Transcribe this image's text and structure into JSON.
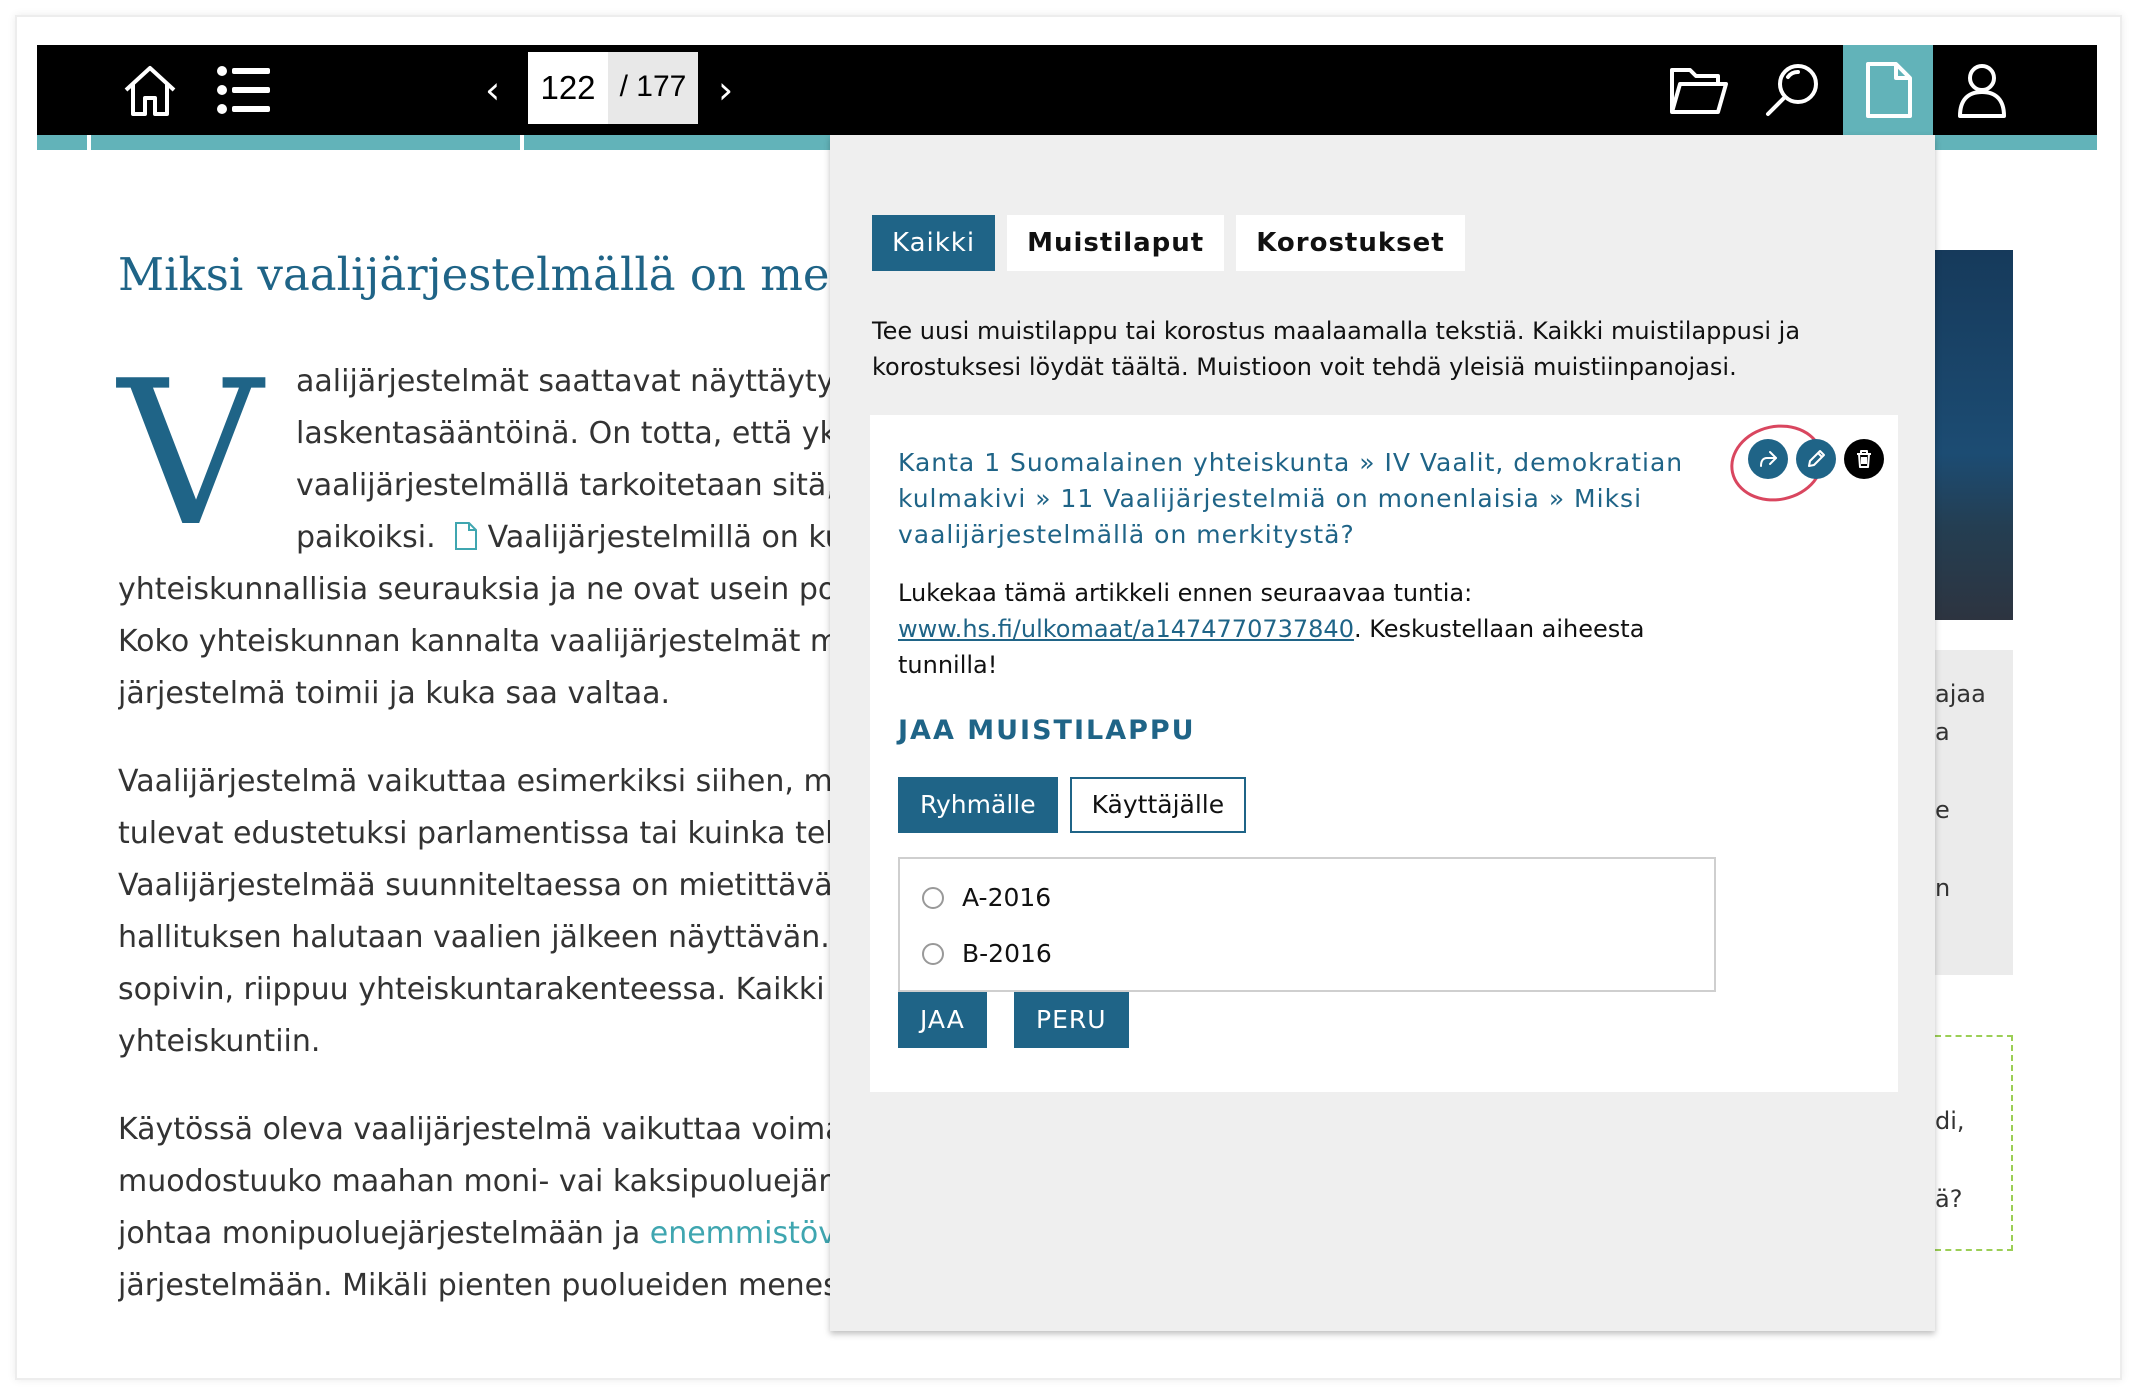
{
  "toolbar": {
    "home_icon": "home-icon",
    "menu_icon": "list-menu-icon",
    "prev_arrow": "‹",
    "next_arrow": "›",
    "current_page": "122",
    "total_pages": "/ 177",
    "folder_icon": "folder-icon",
    "search_icon": "search-icon",
    "notes_icon": "document-icon",
    "user_icon": "user-icon",
    "accent_color": "#62b3b9"
  },
  "article": {
    "title": "Miksi vaalijärjestelmällä on me",
    "dropcap": "V",
    "paragraphs": [
      {
        "lines": [
          "aalijärjestelmät saattavat näyttäytyä v",
          "laskentasääntöinä. On totta, että yksin",
          "vaalijärjestelmällä tarkoitetaan sitä, m",
          "paikoiksi.",
          "yhteiskunnallisia seurauksia ja ne ovat usein poliit",
          "Koko yhteiskunnan kannalta vaalijärjestelmät mää",
          "järjestelmä toimii ja kuka saa valtaa."
        ],
        "inline_link_text": "Vaalijärjestelmillä on ku"
      },
      {
        "lines": [
          "Vaalijärjestelmä vaikuttaa esimerkiksi siihen, miss",
          "tulevat edustetuksi parlamentissa tai kuinka tehok",
          "Vaalijärjestelmää suunniteltaessa on mietittävä ta",
          "hallituksen halutaan vaalien jälkeen näyttävän. Se",
          "sopivin, riippuu yhteiskuntarakenteessa. Kaikki va",
          "yhteiskuntiin."
        ]
      },
      {
        "lines": [
          "Käytössä oleva vaalijärjestelmä vaikuttaa voimakk",
          "muodostuuko maahan moni- vai kaksipuoluejärjes",
          "johtaa monipuoluejärjestelmään ja",
          "järjestelmään. Mikäli pienten puolueiden menesty"
        ],
        "link_text": "enemmistövaa"
      }
    ],
    "heading_color": "#1f6487"
  },
  "side": {
    "box_lines": [
      "ajaa",
      "a",
      "e",
      "n"
    ],
    "dashed_lines": [
      "di,",
      "ä?"
    ]
  },
  "panel": {
    "tabs": [
      "Kaikki",
      "Muistilaput",
      "Korostukset"
    ],
    "intro": "Tee uusi muistilappu tai korostus maalaamalla tekstiä. Kaikki muistilappusi ja korostuksesi löydät täältä. Muistioon voit tehdä yleisiä muistiinpanojasi.",
    "note": {
      "breadcrumb": "Kanta 1 Suomalainen yhteiskunta » IV Vaalit, demokratian kulmakivi » 11 Vaalijärjestelmiä on monenlaisia » Miksi vaalijärjestelmällä on merkitystä?",
      "body_before": "Lukekaa tämä artikkeli ennen seuraavaa tuntia:",
      "link": "www.hs.fi/ulkomaat/a1474770737840",
      "body_after": ". Keskustellaan aiheesta tunnilla!",
      "actions": [
        "share-icon",
        "edit-icon",
        "delete-icon"
      ],
      "share_heading": "JAA MUISTILAPPU",
      "share_tabs": [
        "Ryhmälle",
        "Käyttäjälle"
      ],
      "groups": [
        "A-2016",
        "B-2016"
      ],
      "share_button": "JAA",
      "cancel_button": "PERU"
    }
  }
}
